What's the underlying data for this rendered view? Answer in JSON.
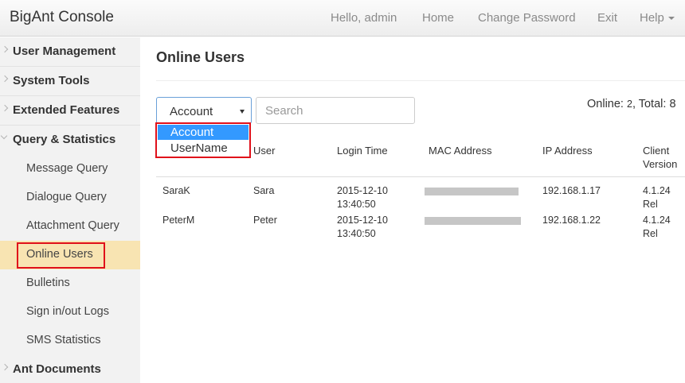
{
  "app": {
    "title": "BigAnt Console"
  },
  "nav": {
    "greeting": "Hello, admin",
    "home": "Home",
    "change_password": "Change Password",
    "exit": "Exit",
    "help": "Help"
  },
  "sidebar": {
    "user_management": "User Management",
    "system_tools": "System Tools",
    "extended_features": "Extended Features",
    "query_statistics": "Query & Statistics",
    "items": [
      {
        "label": "Message Query"
      },
      {
        "label": "Dialogue Query"
      },
      {
        "label": "Attachment Query"
      },
      {
        "label": "Online Users",
        "active": true
      },
      {
        "label": "Bulletins"
      },
      {
        "label": "Sign in/out Logs"
      },
      {
        "label": "SMS Statistics"
      }
    ],
    "ant_documents": "Ant Documents"
  },
  "main": {
    "title": "Online Users",
    "filter": {
      "selected": "Account",
      "options": [
        "Account",
        "UserName"
      ],
      "search_placeholder": "Search"
    },
    "counts": {
      "online_label": "Online:",
      "online_value": "2",
      "total_label": "Total:",
      "total_value": "8"
    },
    "table": {
      "headers": {
        "user": "User",
        "login_time": "Login Time",
        "mac_address": "MAC Address",
        "ip_address": "IP Address",
        "client_version_1": "Client",
        "client_version_2": "Version"
      },
      "rows": [
        {
          "account": "SaraK",
          "user": "Sara",
          "login_date": "2015-12-10",
          "login_time": "13:40:50",
          "ip": "192.168.1.17",
          "version": "4.1.24",
          "version_tag": "Rel"
        },
        {
          "account": "PeterM",
          "user": "Peter",
          "login_date": "2015-12-10",
          "login_time": "13:40:50",
          "ip": "192.168.1.22",
          "version": "4.1.24",
          "version_tag": "Rel"
        }
      ]
    }
  }
}
